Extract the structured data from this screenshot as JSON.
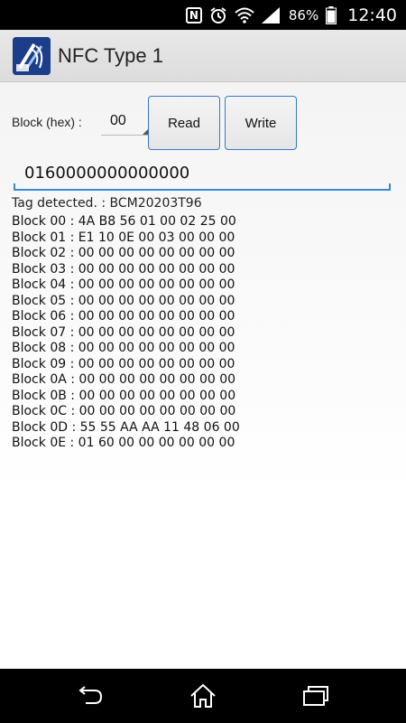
{
  "status_bar": {
    "battery_percent": "86%",
    "time": "12:40",
    "icons": [
      "nfc-icon",
      "alarm-icon",
      "wifi-icon",
      "signal-icon",
      "battery-icon"
    ]
  },
  "app": {
    "title": "NFC Type 1",
    "logo_icon": "nfc-app-logo-icon"
  },
  "controls": {
    "block_label": "Block (hex) :",
    "block_value": "00",
    "read_label": "Read",
    "write_label": "Write"
  },
  "input": {
    "value": "0160000000000000"
  },
  "tag": {
    "detected": "Tag detected. : BCM20203T96"
  },
  "blocks": [
    "Block 00 : 4A B8 56 01 00 02 25 00",
    "Block 01 : E1 10 0E 00 03 00 00 00",
    "Block 02 : 00 00 00 00 00 00 00 00",
    "Block 03 : 00 00 00 00 00 00 00 00",
    "Block 04 : 00 00 00 00 00 00 00 00",
    "Block 05 : 00 00 00 00 00 00 00 00",
    "Block 06 : 00 00 00 00 00 00 00 00",
    "Block 07 : 00 00 00 00 00 00 00 00",
    "Block 08 : 00 00 00 00 00 00 00 00",
    "Block 09 : 00 00 00 00 00 00 00 00",
    "Block 0A : 00 00 00 00 00 00 00 00",
    "Block 0B : 00 00 00 00 00 00 00 00",
    "Block 0C : 00 00 00 00 00 00 00 00",
    "Block 0D : 55 55 AA AA 11 48 06 00",
    "Block 0E : 01 60 00 00 00 00 00 00"
  ],
  "nav": {
    "icons": [
      "back-icon",
      "home-icon",
      "recents-icon"
    ]
  },
  "colors": {
    "accent": "#3a8ad6",
    "button_border": "#3a78c8",
    "logo_bg": "#1c3d8a"
  }
}
